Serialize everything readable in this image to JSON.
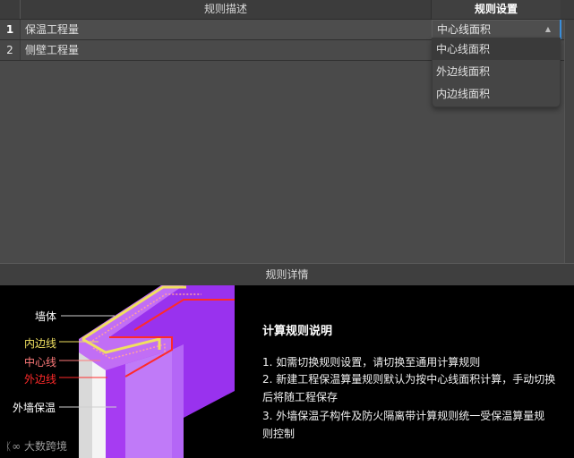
{
  "table": {
    "headers": {
      "description": "规则描述",
      "rule": "规则设置"
    },
    "rows": [
      {
        "index": "1",
        "description": "保温工程量",
        "rule": "中心线面积"
      },
      {
        "index": "2",
        "description": "侧壁工程量",
        "rule": ""
      }
    ]
  },
  "dropdown": {
    "selected": "中心线面积",
    "options": [
      "中心线面积",
      "外边线面积",
      "内边线面积"
    ]
  },
  "detail": {
    "title": "规则详情",
    "diagram_labels": {
      "wall": "墙体",
      "inner_line": "内边线",
      "center_line": "中心线",
      "outer_line": "外边线",
      "insulation": "外墙保温"
    },
    "info": {
      "title": "计算规则说明",
      "lines": [
        "1. 如需切换规则设置，请切换至通用计算规则",
        "2. 新建工程保温算量规则默认为按中心线面积计算，手动切换",
        "后将随工程保存",
        "3. 外墙保温子构件及防火隔离带计算规则统一受保温算量规",
        "则控制"
      ]
    },
    "watermark": "大数跨境"
  },
  "colors": {
    "inner_line": "#f0e060",
    "center_line": "#ff7a7a",
    "outer_line": "#ff2a2a",
    "insulation": "#a040f0",
    "dropdown_edge": "#3a8edb"
  },
  "icons": {
    "dropdown_caret": "caret-up-icon"
  }
}
